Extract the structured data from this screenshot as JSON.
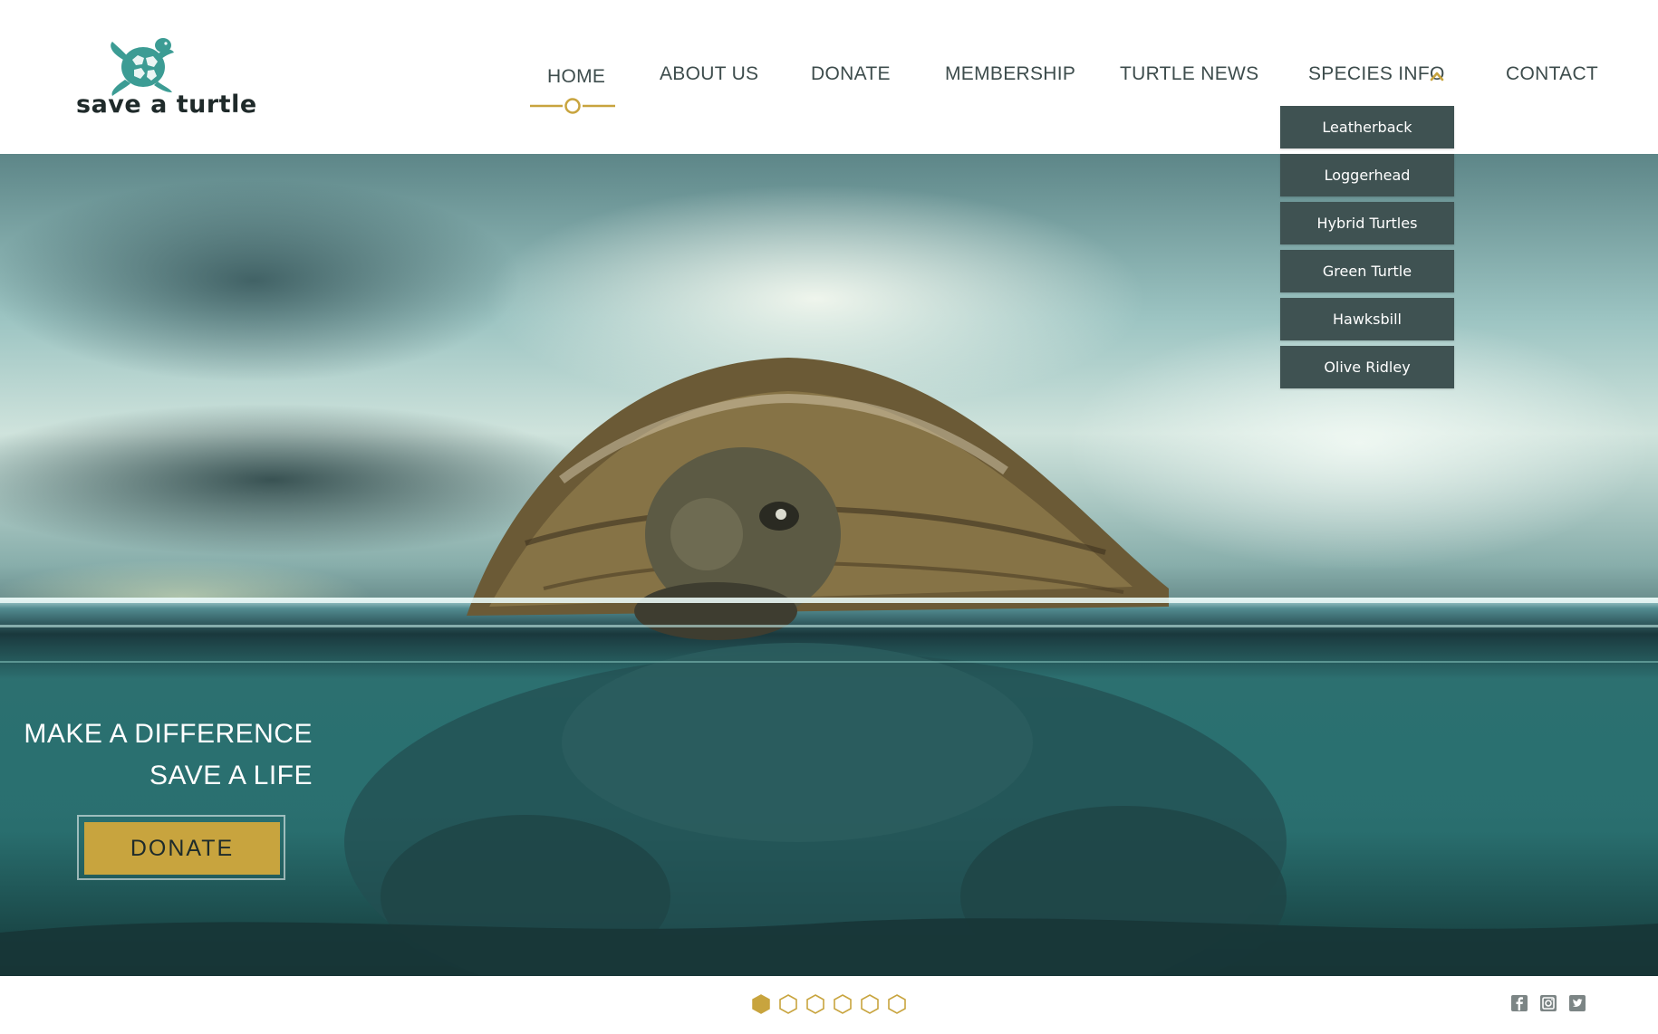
{
  "brand": {
    "name": "save a turtle",
    "logo_icon": "turtle-logo-icon",
    "colors": {
      "accent_gold": "#c8a43e",
      "logo_teal": "#3c9c94",
      "dropdown_bg": "#3f5252",
      "nav_text": "#3d4c4c"
    }
  },
  "nav": {
    "items": [
      {
        "label": "HOME",
        "active": true
      },
      {
        "label": "ABOUT US"
      },
      {
        "label": "DONATE"
      },
      {
        "label": "MEMBERSHIP"
      },
      {
        "label": "TURTLE NEWS"
      },
      {
        "label": "SPECIES INFO",
        "expanded": true,
        "icon": "chevron-up-icon"
      },
      {
        "label": "CONTACT"
      }
    ]
  },
  "species_dropdown": {
    "items": [
      "Leatherback",
      "Loggerhead",
      "Hybrid Turtles",
      "Green Turtle",
      "Hawksbill",
      "Olive Ridley"
    ]
  },
  "hero": {
    "image": "turtle-in-sea-photo",
    "tagline_line1": "MAKE  A DIFFERENCE",
    "tagline_line2": "SAVE A LIFE",
    "cta_label": "DONATE"
  },
  "carousel": {
    "slide_count": 6,
    "active_index": 0
  },
  "social": {
    "icons": [
      "facebook-icon",
      "instagram-icon",
      "twitter-icon"
    ]
  }
}
